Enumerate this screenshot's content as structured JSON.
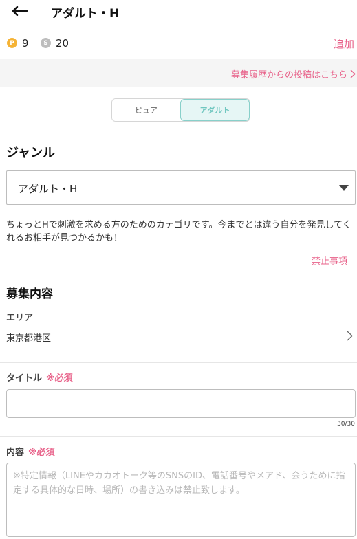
{
  "header": {
    "title": "アダルト・H"
  },
  "points": {
    "p_icon_label": "P",
    "p_count": "9",
    "s_icon_label": "S",
    "s_count": "20",
    "add_label": "追加"
  },
  "history": {
    "link_label": "募集履歴からの投稿はこちら"
  },
  "segment": {
    "tabs": [
      {
        "label": "ピュア",
        "active": false
      },
      {
        "label": "アダルト",
        "active": true
      }
    ]
  },
  "genre": {
    "heading": "ジャンル",
    "selected": "アダルト・H",
    "description": "ちょっとHで刺激を求める方のためのカテゴリです。今までとは違う自分を発見してくれるお相手が見つかるかも！",
    "prohibited_label": "禁止事項"
  },
  "recruit": {
    "heading": "募集内容",
    "area_label": "エリア",
    "area_value": "東京都港区",
    "title_label": "タイトル",
    "required_mark": "※必須",
    "title_counter": "30/30",
    "content_label": "内容",
    "content_placeholder": "※特定情報（LINEやカカオトーク等のSNSのID、電話番号やメアド、会うために指定する具体的な日時、場所）の書き込みは禁止致します。"
  },
  "colors": {
    "accent": "#e8628a",
    "tab_active": "#70c7c0",
    "point_gold": "#f5b335",
    "point_gray": "#bdbdbd"
  }
}
